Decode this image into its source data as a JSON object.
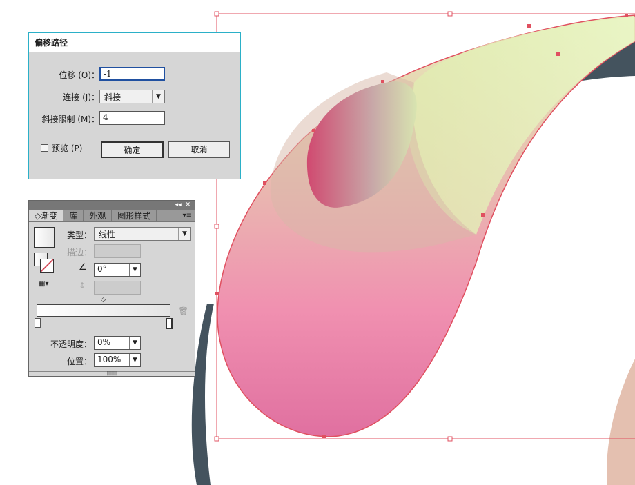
{
  "offset_dialog": {
    "title": "偏移路径",
    "offset_label": "位移 (O)：",
    "offset_value": "-1",
    "join_label": "连接 (J)：",
    "join_value": "斜接",
    "miter_label": "斜接限制 (M)：",
    "miter_value": "4",
    "preview_label": "预览 (P)",
    "preview_checked": false,
    "ok_label": "确定",
    "cancel_label": "取消"
  },
  "gradient_panel": {
    "tabs": [
      {
        "label": "渐变",
        "active": true
      },
      {
        "label": "库"
      },
      {
        "label": "外观"
      },
      {
        "label": "图形样式"
      }
    ],
    "type_label": "类型：",
    "type_value": "线性",
    "stroke_label": "描边：",
    "angle_value": "0°",
    "opacity_label": "不透明度：",
    "opacity_value": "0%",
    "location_label": "位置：",
    "location_value": "100%"
  },
  "colors": {
    "accent": "#2bb0c8",
    "selection": "#e05060",
    "pink": "#e8789f",
    "green": "#e4f0b8",
    "slate": "#44535e"
  }
}
